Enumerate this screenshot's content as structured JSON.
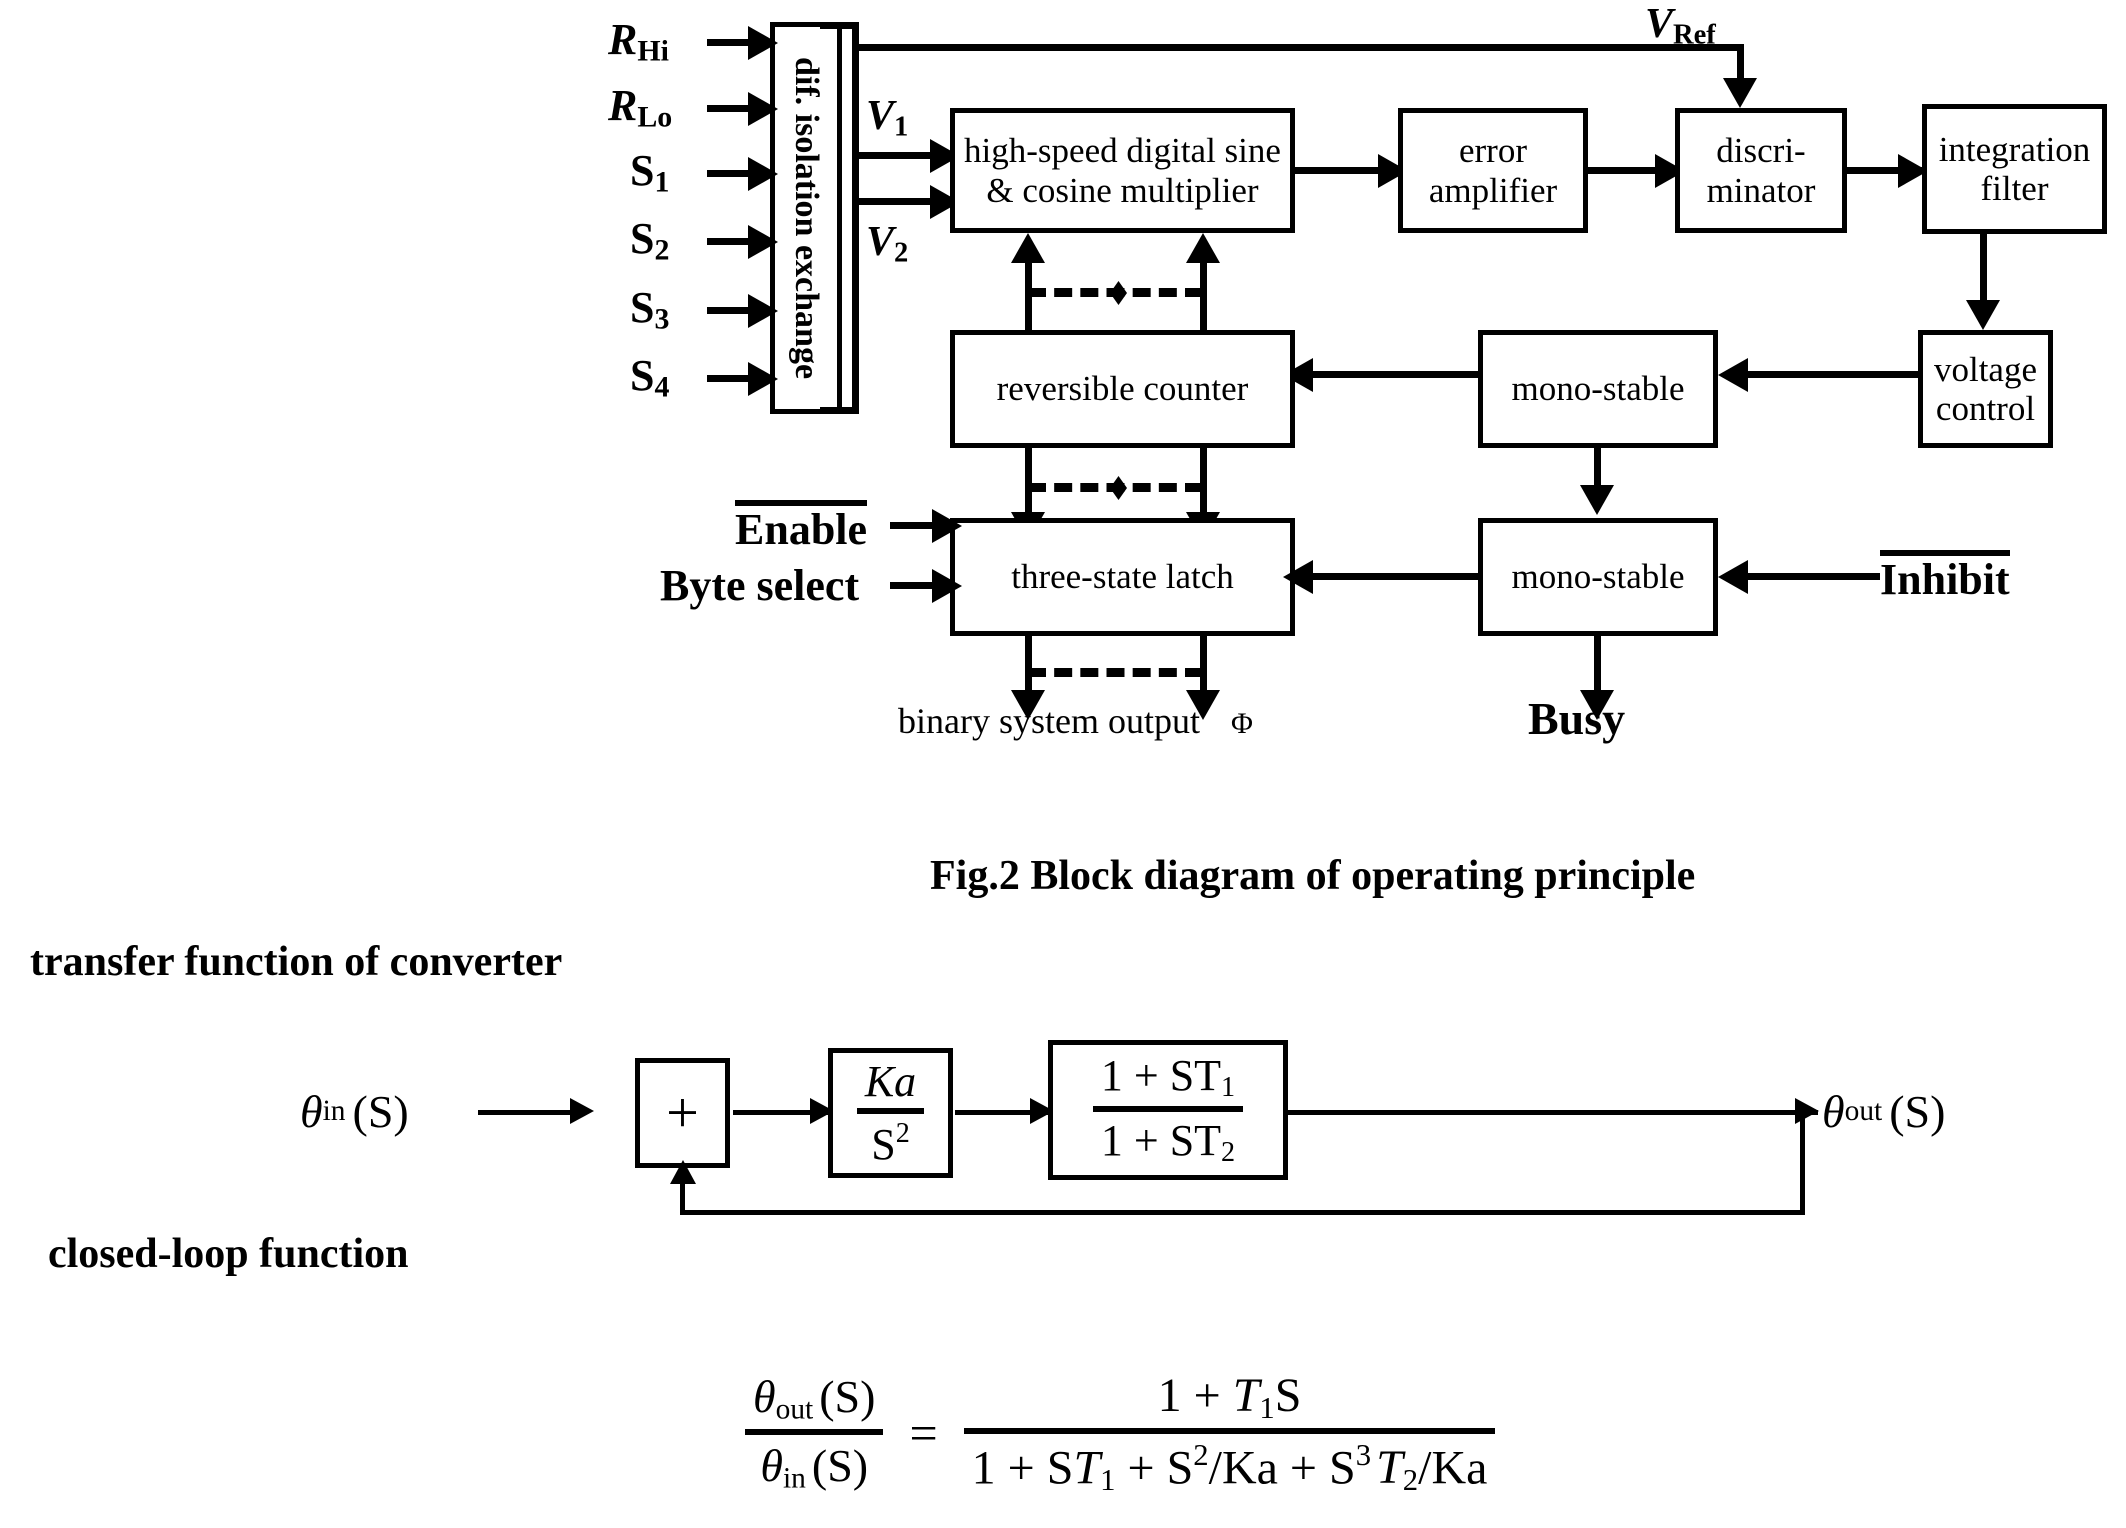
{
  "figure": {
    "caption": "Fig.2  Block diagram of operating principle"
  },
  "top_diagram": {
    "isolation_block": {
      "label": "dif. isolation exchange"
    },
    "inputs": [
      {
        "name": "R",
        "sub": "Hi",
        "italic": true
      },
      {
        "name": "R",
        "sub": "Lo",
        "italic": true
      },
      {
        "name": "S",
        "sub": "1",
        "italic": false
      },
      {
        "name": "S",
        "sub": "2",
        "italic": false
      },
      {
        "name": "S",
        "sub": "3",
        "italic": false
      },
      {
        "name": "S",
        "sub": "4",
        "italic": false
      }
    ],
    "intermediate_signals": [
      {
        "name": "V",
        "sub": "1"
      },
      {
        "name": "V",
        "sub": "2"
      }
    ],
    "reference_signal": {
      "name": "V",
      "sub": "Ref"
    },
    "blocks": {
      "multiplier": "high-speed digital sine & cosine multiplier",
      "multiplier_line1": "high-speed digital sine",
      "multiplier_line2": "& cosine multiplier",
      "error_amplifier_line1": "error",
      "error_amplifier_line2": "amplifier",
      "discriminator_line1": "discri-",
      "discriminator_line2": "minator",
      "integration_filter_line1": "integration",
      "integration_filter_line2": "filter",
      "voltage_control_line1": "voltage",
      "voltage_control_line2": "control",
      "reversible_counter": "reversible counter",
      "mono_stable_upper": "mono-stable",
      "mono_stable_lower": "mono-stable",
      "three_state_latch": "three-state latch"
    },
    "control_inputs": {
      "enable": "Enable",
      "byte_select": "Byte select",
      "inhibit": "Inhibit"
    },
    "outputs": {
      "binary_system_output": "binary system output",
      "binary_system_output_symbol": "Φ",
      "busy": "Busy"
    }
  },
  "transfer_section": {
    "heading": "transfer function of converter",
    "input_label": {
      "theta": "θ",
      "sub": "in",
      "arg": "(S)"
    },
    "output_label": {
      "theta": "θ",
      "sub": "out",
      "arg": "(S)"
    },
    "summing_junction": "+",
    "block_gain": {
      "num": "Ka",
      "den": "S²",
      "den_base": "S",
      "den_sup": "2"
    },
    "block_lead_lag": {
      "num_prefix": "1 + ST",
      "num_sub": "1",
      "den_prefix": "1 + ST",
      "den_sub": "2"
    }
  },
  "closed_loop_section": {
    "heading": "closed-loop function",
    "lhs": {
      "num": {
        "theta": "θ",
        "sub": "out",
        "arg": "(S)"
      },
      "den": {
        "theta": "θ",
        "sub": "in",
        "arg": "(S)"
      }
    },
    "equals": "=",
    "rhs": {
      "numerator": "1 + T₁S",
      "num_parts": [
        "1 + ",
        "T",
        "1",
        "S"
      ],
      "denominator": "1 + ST₁ + S²/Ka + S³T₂/Ka",
      "den_parts": [
        "1 + S",
        "T",
        "1",
        " + S",
        "2",
        "/Ka + S",
        "3",
        "T",
        "2",
        "/Ka"
      ]
    }
  },
  "colors": {
    "line": "#000000",
    "background": "#ffffff"
  }
}
